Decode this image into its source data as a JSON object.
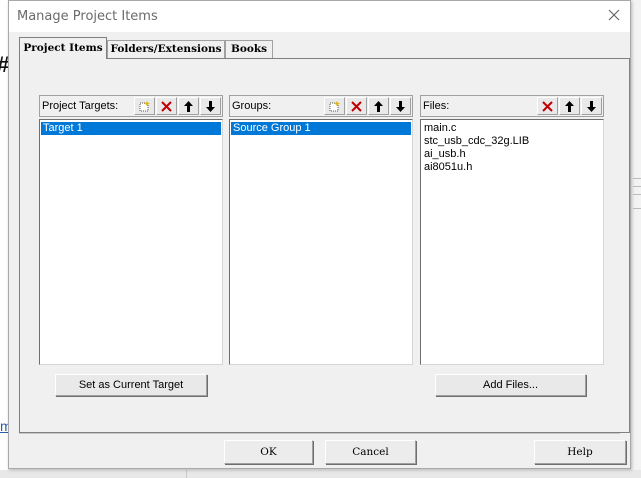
{
  "dialog": {
    "title": "Manage Project Items"
  },
  "tabs": [
    {
      "label": "Project Items",
      "active": true
    },
    {
      "label": "Folders/Extensions",
      "active": false
    },
    {
      "label": "Books",
      "active": false
    }
  ],
  "panels": {
    "targets": {
      "label": "Project Targets:",
      "tools": [
        "new-icon",
        "delete-icon",
        "move-up-icon",
        "move-down-icon"
      ],
      "items": [
        {
          "text": "Target 1",
          "selected": true
        }
      ],
      "button": "Set as Current Target"
    },
    "groups": {
      "label": "Groups:",
      "tools": [
        "new-icon",
        "delete-icon",
        "move-up-icon",
        "move-down-icon"
      ],
      "items": [
        {
          "text": "Source Group 1",
          "selected": true
        }
      ]
    },
    "files": {
      "label": "Files:",
      "tools": [
        "delete-icon",
        "move-up-icon",
        "move-down-icon"
      ],
      "items": [
        {
          "text": "main.c",
          "selected": false
        },
        {
          "text": "stc_usb_cdc_32g.LIB",
          "selected": false
        },
        {
          "text": "ai_usb.h",
          "selected": false
        },
        {
          "text": "ai8051u.h",
          "selected": false
        }
      ],
      "button": "Add Files..."
    }
  },
  "footer": {
    "ok": "OK",
    "cancel": "Cancel",
    "help": "Help"
  },
  "colors": {
    "selection": "#0078d7",
    "delete_red": "#c00000"
  }
}
